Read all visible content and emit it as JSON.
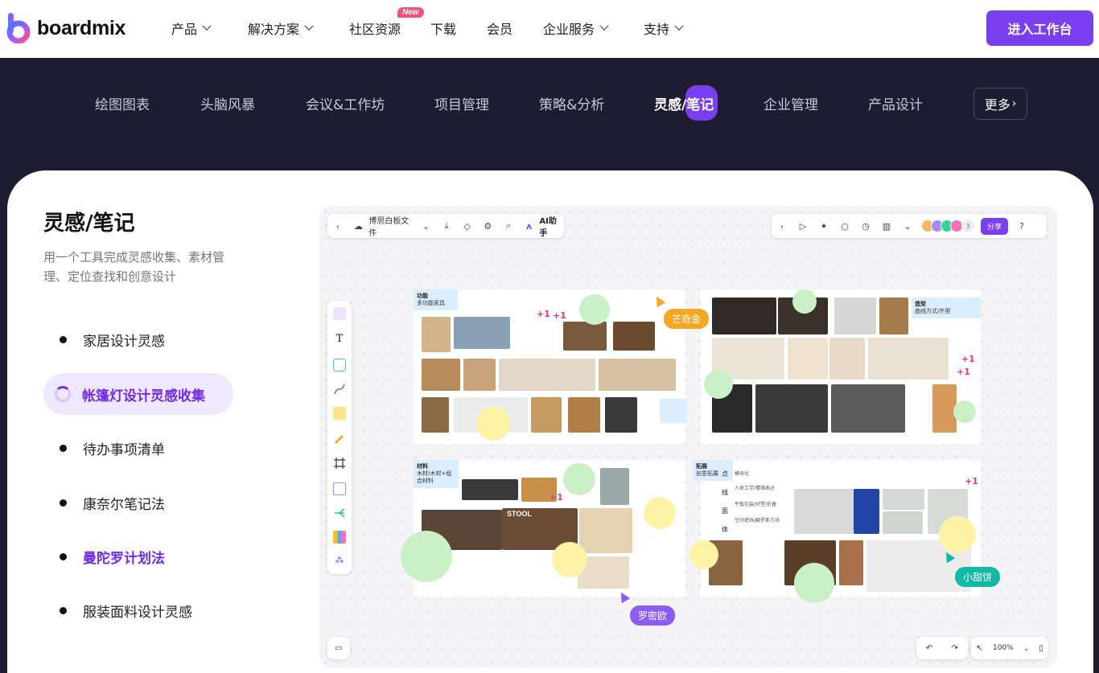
{
  "brand": {
    "name": "boardmix"
  },
  "nav": {
    "items": [
      {
        "label": "产品",
        "dropdown": true
      },
      {
        "label": "解决方案",
        "dropdown": true
      },
      {
        "label": "社区资源",
        "dropdown": false,
        "badge": "New"
      },
      {
        "label": "下载",
        "dropdown": false
      },
      {
        "label": "会员",
        "dropdown": false
      },
      {
        "label": "企业服务",
        "dropdown": true
      },
      {
        "label": "支持",
        "dropdown": true
      }
    ],
    "cta_label": "进入工作台"
  },
  "categories": {
    "items": [
      "绘图图表",
      "头脑风暴",
      "会议&工作坊",
      "项目管理",
      "策略&分析",
      "灵感/笔记",
      "企业管理",
      "产品设计"
    ],
    "active": "灵感/笔记",
    "more_label": "更多"
  },
  "sidebar": {
    "title": "灵感/笔记",
    "description": "用一个工具完成灵感收集、素材管理、定位查找和创意设计",
    "items": [
      {
        "label": "家居设计灵感",
        "state": "normal"
      },
      {
        "label": "帐篷灯设计灵感收集",
        "state": "active"
      },
      {
        "label": "待办事项清单",
        "state": "normal"
      },
      {
        "label": "康奈尔笔记法",
        "state": "normal"
      },
      {
        "label": "曼陀罗计划法",
        "state": "highlight"
      },
      {
        "label": "服装面料设计灵感",
        "state": "normal"
      }
    ]
  },
  "board": {
    "file_name": "博思白板文件",
    "ai_label": "AI助手",
    "share_label": "分享",
    "collaborator_count": "3",
    "zoom": "100%",
    "frames": {
      "function_tag": {
        "title": "功能",
        "subtitle": "多功能家具"
      },
      "shape_tag": {
        "title": "造型",
        "subtitle": "曲线方式/外型"
      },
      "material_tag": {
        "title": "材料",
        "subtitle": "木材/木材+组合材料"
      },
      "extend_tag": {
        "title": "拓展",
        "subtitle": "创意拓展"
      },
      "stool_word": "STOOL",
      "flow_steps": [
        "点",
        "线",
        "面",
        "体"
      ],
      "flow_labels": [
        "模块化",
        "人体工学/情绪表达",
        "平板包装/好塑/折叠",
        "空间遮挡/翻罗斯方块"
      ]
    },
    "cursors": [
      {
        "name": "芒奇金",
        "color": "#f5a623"
      },
      {
        "name": "罗密欧",
        "color": "#8b5cf6"
      },
      {
        "name": "小甜饼",
        "color": "#14b8a6"
      }
    ],
    "plus_one": "+1"
  }
}
